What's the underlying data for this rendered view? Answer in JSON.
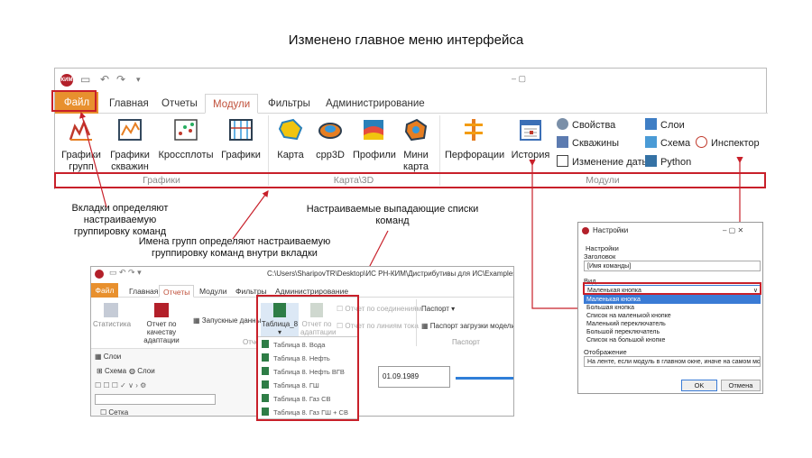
{
  "slide_title": "Изменено главное меню интерфейса",
  "main_window": {
    "tabs": [
      "Файл",
      "Главная",
      "Отчеты",
      "Модули",
      "Фильтры",
      "Администрирование"
    ],
    "active_tab": "Модули",
    "buttons": {
      "graph_groups": "Графики групп",
      "graph_wells": "Графики скважин",
      "crossplots": "Кроссплоты",
      "graphs": "Графики",
      "map": "Карта",
      "cpp3d": "cpp3D",
      "profiles": "Профили",
      "minimap": "Мини карта",
      "perforations": "Перфорации",
      "history": "История"
    },
    "small_buttons": {
      "properties": "Свойства",
      "wells": "Скважины",
      "change_date": "Изменение даты",
      "layers": "Слои",
      "scheme": "Схема",
      "python": "Python",
      "inspector": "Инспектор"
    },
    "groups": {
      "graphs": "Графики",
      "map3d": "Карта\\3D",
      "modules": "Модули"
    }
  },
  "annotations": {
    "tabs_note": "Вкладки определяют настраиваемую\nгруппировку команд",
    "groups_note": "Имена групп определяют настраиваемую\nгруппировку команд внутри вкладки",
    "dropdown_note": "Настраиваемые выпадающие списки\nкоманд"
  },
  "second_window": {
    "path": "C:\\Users\\SharipovTR\\Desktop\\ИС РН-КИМ\\Дистрибутивы для ИС\\Examples_web\\29x24",
    "tabs": [
      "Файл",
      "Главная",
      "Отчеты",
      "Модули",
      "Фильтры",
      "Администрирование"
    ],
    "active_tab": "Отчеты",
    "buttons": {
      "statistics": "Статистика",
      "quality_report": "Отчет по качеству адаптации",
      "launched_data": "Запускные данные",
      "table8": "Таблица_8",
      "adapt_report": "Отчет по адаптации",
      "by_connections": "Отчет по соединениям",
      "by_flow_lines": "Отчет по линиям тока",
      "passport": "Паспорт",
      "passport_load": "Паспорт загрузки модели"
    },
    "groups": {
      "reports": "Отчет",
      "passport": "Паспорт"
    },
    "panel": {
      "layers": "Слои",
      "scheme_tab": "Схема",
      "layers_tab": "Слои",
      "grid": "Сетка"
    },
    "date": "01.09.1989",
    "dropdown": [
      "Таблица 8. Вода",
      "Таблица 8. Нефть",
      "Таблица 8. Нефть ВГВ",
      "Таблица 8. ГШ",
      "Таблица 8. Газ СВ",
      "Таблица 8. Газ ГШ + СВ"
    ]
  },
  "dialog": {
    "title": "Настройки",
    "section": "Настройки",
    "header_label": "Заголовок",
    "header_value": "[Имя команды]",
    "view_label": "Вид",
    "view_value": "Маленькая кнопка",
    "view_options": [
      "Маленькая кнопка",
      "Большая кнопка",
      "Список на маленькой кнопке",
      "Маленький переключатель",
      "Большой переключатель",
      "Список на большой кнопке"
    ],
    "display_label": "Отображение",
    "display_value": "На ленте, если модуль в главном окне, иначе на самом моду",
    "ok": "OK",
    "cancel": "Отмена"
  },
  "colors": {
    "accent": "#c8202a",
    "file_tab": "#e8902e"
  }
}
